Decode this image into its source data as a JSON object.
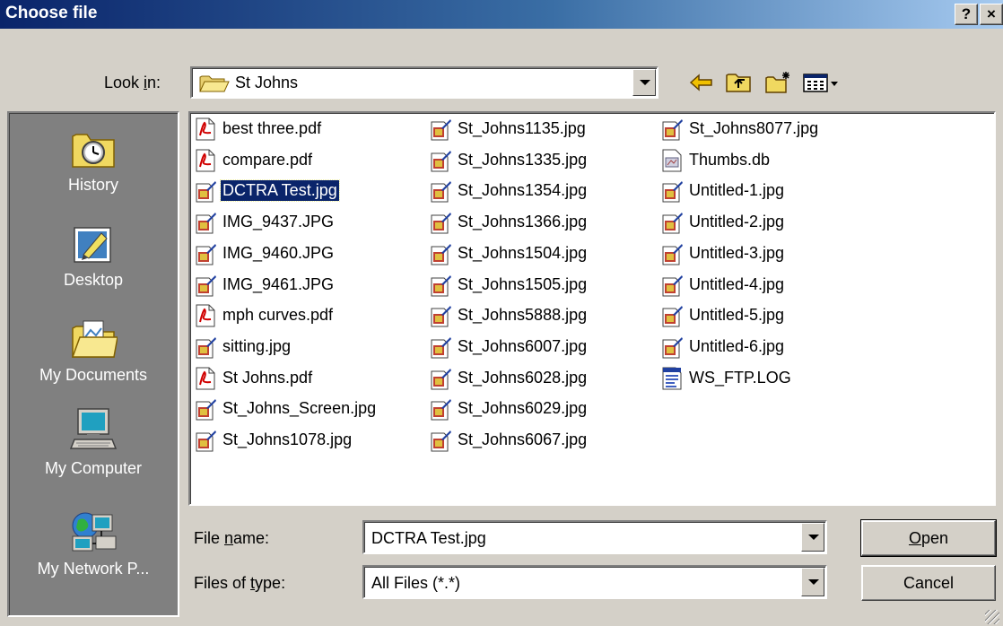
{
  "window": {
    "title": "Choose file",
    "help_label": "?",
    "close_label": "×"
  },
  "lookin": {
    "label_pre": "Look ",
    "label_key": "i",
    "label_post": "n:",
    "value": "St Johns",
    "icon": "folder-open-icon"
  },
  "toolbar": [
    "back-arrow-icon",
    "up-folder-icon",
    "new-folder-icon",
    "view-menu-icon"
  ],
  "places": [
    {
      "label": "History",
      "icon": "history-icon"
    },
    {
      "label": "Desktop",
      "icon": "desktop-icon"
    },
    {
      "label": "My Documents",
      "icon": "my-documents-icon"
    },
    {
      "label": "My Computer",
      "icon": "my-computer-icon"
    },
    {
      "label": "My Network P...",
      "icon": "my-network-places-icon"
    }
  ],
  "files": {
    "col1": [
      {
        "name": "best three.pdf",
        "icon": "pdf"
      },
      {
        "name": "compare.pdf",
        "icon": "pdf"
      },
      {
        "name": "DCTRA Test.jpg",
        "icon": "jpg",
        "selected": true
      },
      {
        "name": "IMG_9437.JPG",
        "icon": "jpg"
      },
      {
        "name": "IMG_9460.JPG",
        "icon": "jpg"
      },
      {
        "name": "IMG_9461.JPG",
        "icon": "jpg"
      },
      {
        "name": "mph curves.pdf",
        "icon": "pdf"
      },
      {
        "name": "sitting.jpg",
        "icon": "jpg"
      },
      {
        "name": "St Johns.pdf",
        "icon": "pdf"
      },
      {
        "name": "St_Johns_Screen.jpg",
        "icon": "jpg"
      },
      {
        "name": "St_Johns1078.jpg",
        "icon": "jpg"
      }
    ],
    "col2": [
      {
        "name": "St_Johns1135.jpg",
        "icon": "jpg"
      },
      {
        "name": "St_Johns1335.jpg",
        "icon": "jpg"
      },
      {
        "name": "St_Johns1354.jpg",
        "icon": "jpg"
      },
      {
        "name": "St_Johns1366.jpg",
        "icon": "jpg"
      },
      {
        "name": "St_Johns1504.jpg",
        "icon": "jpg"
      },
      {
        "name": "St_Johns1505.jpg",
        "icon": "jpg"
      },
      {
        "name": "St_Johns5888.jpg",
        "icon": "jpg"
      },
      {
        "name": "St_Johns6007.jpg",
        "icon": "jpg"
      },
      {
        "name": "St_Johns6028.jpg",
        "icon": "jpg"
      },
      {
        "name": "St_Johns6029.jpg",
        "icon": "jpg"
      },
      {
        "name": "St_Johns6067.jpg",
        "icon": "jpg"
      }
    ],
    "col3": [
      {
        "name": "St_Johns8077.jpg",
        "icon": "jpg"
      },
      {
        "name": "Thumbs.db",
        "icon": "db"
      },
      {
        "name": "Untitled-1.jpg",
        "icon": "jpg"
      },
      {
        "name": "Untitled-2.jpg",
        "icon": "jpg"
      },
      {
        "name": "Untitled-3.jpg",
        "icon": "jpg"
      },
      {
        "name": "Untitled-4.jpg",
        "icon": "jpg"
      },
      {
        "name": "Untitled-5.jpg",
        "icon": "jpg"
      },
      {
        "name": "Untitled-6.jpg",
        "icon": "jpg"
      },
      {
        "name": "WS_FTP.LOG",
        "icon": "log"
      }
    ]
  },
  "filename": {
    "label_pre": "File ",
    "label_key": "n",
    "label_post": "ame:",
    "value": "DCTRA Test.jpg"
  },
  "filetype": {
    "label_pre": "Files of ",
    "label_key": "t",
    "label_post": "ype:",
    "value": "All Files (*.*)"
  },
  "buttons": {
    "open_key": "O",
    "open_rest": "pen",
    "cancel": "Cancel"
  },
  "colors": {
    "selection": "#0a246a",
    "face": "#d4d0c8",
    "places_bg": "#808080"
  }
}
